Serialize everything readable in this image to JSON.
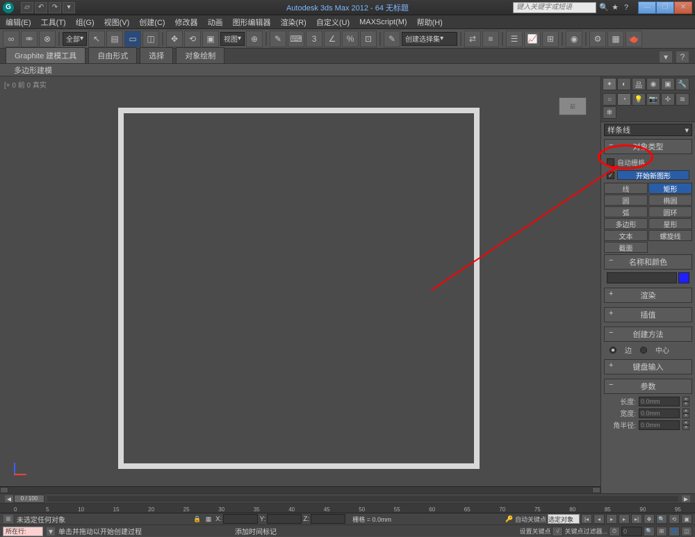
{
  "title": "Autodesk 3ds Max 2012 - 64   无标题",
  "search_placeholder": "键入关键字或短语",
  "menu": [
    "编辑(E)",
    "工具(T)",
    "组(G)",
    "视图(V)",
    "创建(C)",
    "修改器",
    "动画",
    "图形编辑器",
    "渲染(R)",
    "自定义(U)",
    "MAXScript(M)",
    "帮助(H)"
  ],
  "toolbar_dropdowns": {
    "all": "全部",
    "view": "视图",
    "create": "创建选择集"
  },
  "ribbon_tabs": [
    "Graphite 建模工具",
    "自由形式",
    "选择",
    "对象绘制"
  ],
  "ribbon_sub": "多边形建模",
  "viewport_label": "[+ 0 前 0 真实",
  "cp": {
    "dropdown": "样条线",
    "object_type_header": "对象类型",
    "autogrid": "自动栅格",
    "start_new": "开始新图形",
    "buttons": [
      "线",
      "矩形",
      "圆",
      "椭圆",
      "弧",
      "圆环",
      "多边形",
      "星形",
      "文本",
      "螺旋线",
      "截面"
    ],
    "selected_button_index": 1,
    "name_color_header": "名称和颜色",
    "render_header": "渲染",
    "interp_header": "插值",
    "create_method_header": "创建方法",
    "radio_edge": "边",
    "radio_center": "中心",
    "keyboard_header": "键盘输入",
    "params_header": "参数",
    "params": {
      "length_label": "长度:",
      "width_label": "宽度:",
      "corner_label": "角半径:",
      "zero": "0.0mm"
    }
  },
  "timeline": {
    "slider": "0 / 100",
    "ticks": [
      "0",
      "5",
      "10",
      "15",
      "20",
      "25",
      "30",
      "35",
      "40",
      "45",
      "50",
      "55",
      "60",
      "65",
      "70",
      "75",
      "80",
      "85",
      "90",
      "95"
    ]
  },
  "status": {
    "selset": "所在行:",
    "none_selected": "未选定任何对象",
    "click_drag": "单击并拖动以开始创建过程",
    "add_marker": "添加时间标记",
    "grid": "栅格 = 0.0mm",
    "auto_key": "自动关键点",
    "set_key": "设置关键点",
    "sel_obj": "选定对象",
    "key_filter": "关键点过滤器..."
  }
}
